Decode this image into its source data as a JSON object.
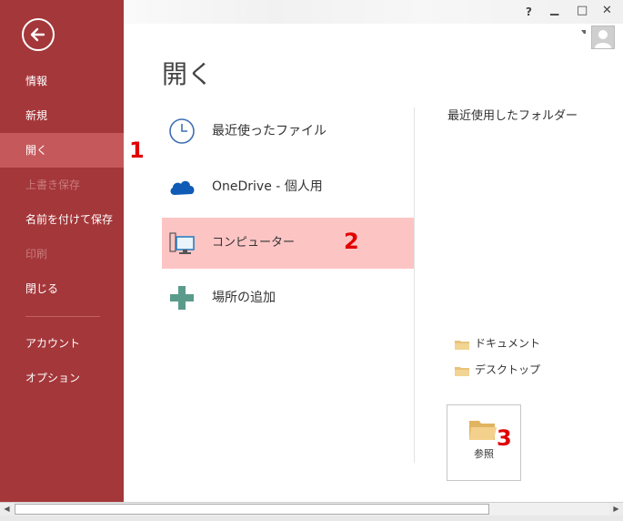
{
  "sidebar": {
    "back_icon": "back-arrow-icon",
    "items": [
      {
        "label": "情報",
        "state": "normal"
      },
      {
        "label": "新規",
        "state": "normal"
      },
      {
        "label": "開く",
        "state": "active"
      },
      {
        "label": "上書き保存",
        "state": "disabled"
      },
      {
        "label": "名前を付けて保存",
        "state": "normal"
      },
      {
        "label": "印刷",
        "state": "disabled"
      },
      {
        "label": "閉じる",
        "state": "normal"
      },
      {
        "label": "アカウント",
        "state": "normal"
      },
      {
        "label": "オプション",
        "state": "normal"
      }
    ]
  },
  "window": {
    "help": "?",
    "minimize": "▁",
    "maximize": "□",
    "close": "✕"
  },
  "main": {
    "title": "開く",
    "places": [
      {
        "label": "最近使ったファイル",
        "icon": "clock-icon"
      },
      {
        "label": "OneDrive - 個人用",
        "icon": "cloud-icon"
      },
      {
        "label": "コンピューター",
        "icon": "computer-icon",
        "selected": true
      },
      {
        "label": "場所の追加",
        "icon": "plus-icon"
      }
    ]
  },
  "right": {
    "recent_title": "最近使用したフォルダー",
    "folders": [
      {
        "label": "ドキュメント",
        "icon": "folder-icon"
      },
      {
        "label": "デスクトップ",
        "icon": "folder-icon"
      }
    ],
    "browse_label": "参照"
  },
  "annotations": {
    "step1": "1",
    "step2": "2",
    "step3": "3"
  },
  "colors": {
    "sidebar": "#a4373a",
    "sidebar_active": "#c5585b",
    "selected_place": "#fdc4c4",
    "annotation": "#e00000"
  }
}
